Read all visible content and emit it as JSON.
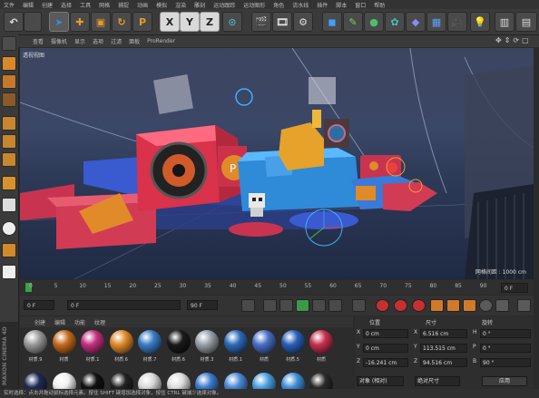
{
  "menu": [
    "文件",
    "编辑",
    "创建",
    "选择",
    "工具",
    "网格",
    "捕捉",
    "动画",
    "模拟",
    "渲染",
    "雕刻",
    "运动跟踪",
    "运动图形",
    "角色",
    "流水线",
    "插件",
    "脚本",
    "窗口",
    "帮助"
  ],
  "toolbar": {
    "x_label": "X",
    "y_label": "Y",
    "z_label": "Z"
  },
  "viewport_menu": [
    "查看",
    "摄像机",
    "显示",
    "选项",
    "过滤",
    "面板",
    "ProRender"
  ],
  "viewport": {
    "label": "透视视图",
    "grid_label": "网格间距 : 1000 cm"
  },
  "timeline": {
    "ticks": [
      "0",
      "5",
      "10",
      "15",
      "20",
      "25",
      "30",
      "35",
      "40",
      "45",
      "50",
      "55",
      "60",
      "65",
      "70",
      "75",
      "80",
      "85",
      "90"
    ],
    "end_field": "0 F"
  },
  "transport": {
    "start_frame": "0 F",
    "current_frame": "0 F",
    "end_frame": "90 F",
    "end_frame2": "90 F"
  },
  "material_menu": [
    "创建",
    "编辑",
    "功能",
    "纹理"
  ],
  "materials_row1": [
    {
      "label": "材质.9",
      "color": "#9a9a9a"
    },
    {
      "label": "材质",
      "color": "#c46a1c"
    },
    {
      "label": "材质.1",
      "color": "#c2307f"
    },
    {
      "label": "材质.6",
      "color": "#e08a2a"
    },
    {
      "label": "材质.7",
      "color": "#3a7cc7"
    },
    {
      "label": "材质.6",
      "color": "#1a1a1a"
    },
    {
      "label": "材质.3",
      "color": "#9aa0a8"
    },
    {
      "label": "材质.1",
      "color": "#2c6bb8"
    },
    {
      "label": "材质",
      "color": "#4a6fc8"
    },
    {
      "label": "材质.5",
      "color": "#2a5fb8"
    },
    {
      "label": "材质",
      "color": "#c93050"
    }
  ],
  "materials_row2_colors": [
    "#1e2a55",
    "#efefef",
    "#111111",
    "#222222",
    "#d8d8d8",
    "#dddddd",
    "#3b7bd0",
    "#4a8ad8",
    "#4aa0e0",
    "#3f8fd8",
    "#2a2a2a"
  ],
  "coord": {
    "headers": [
      "位置",
      "尺寸",
      "旋转"
    ],
    "rows": [
      {
        "axis": "X",
        "pos": "0 cm",
        "size_label": "X",
        "size": "6.516 cm",
        "rot_label": "H",
        "rot": "0 °"
      },
      {
        "axis": "Y",
        "pos": "0 cm",
        "size_label": "Y",
        "size": "113.515 cm",
        "rot_label": "P",
        "rot": "0 °"
      },
      {
        "axis": "Z",
        "pos": "-16.241 cm",
        "size_label": "Z",
        "size": "94.516 cm",
        "rot_label": "B",
        "rot": "90 °"
      }
    ],
    "mode_select": "对象 (相对)",
    "size_select": "绝对尺寸",
    "apply_button": "应用"
  },
  "status": "实时选择：点击并拖动鼠标选择元素。按住 SHIFT 键增加选择对象，按住 CTRL 键减少选择对象。",
  "brand": "MAXON CINEMA 4D"
}
